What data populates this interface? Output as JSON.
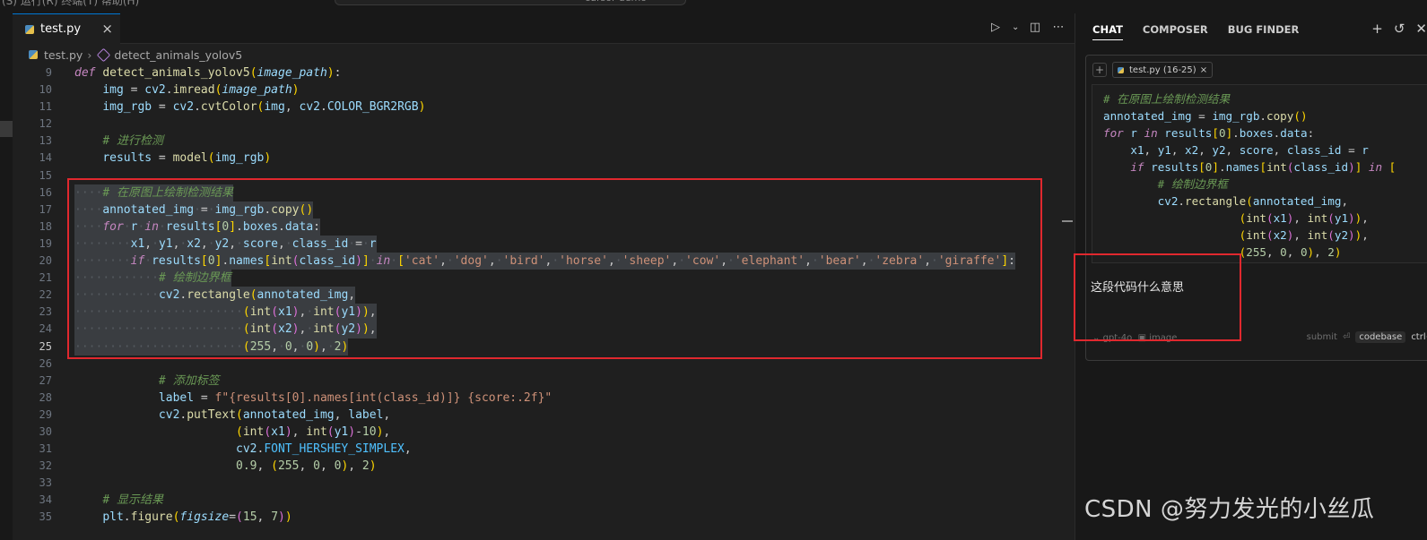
{
  "topbar": {
    "menu_text": "(S)  运行(R)  终端(T)  帮助(H)",
    "command_center": "cursor-demo"
  },
  "tab": {
    "filename": "test.py",
    "close": "×"
  },
  "editor_actions": [
    "run-icon",
    "chevron-down-icon",
    "split-editor-icon",
    "more-icon"
  ],
  "breadcrumb": {
    "file": "test.py",
    "symbol": "detect_animals_yolov5"
  },
  "code_lines": [
    {
      "n": "9",
      "text": "def detect_animals_yolov5(image_path):"
    },
    {
      "n": "10",
      "text": "    img = cv2.imread(image_path)"
    },
    {
      "n": "11",
      "text": "    img_rgb = cv2.cvtColor(img, cv2.COLOR_BGR2RGB)"
    },
    {
      "n": "12",
      "text": ""
    },
    {
      "n": "13",
      "text": "    # 进行检测"
    },
    {
      "n": "14",
      "text": "    results = model(img_rgb)"
    },
    {
      "n": "15",
      "text": ""
    },
    {
      "n": "16",
      "text": "    # 在原图上绘制检测结果"
    },
    {
      "n": "17",
      "text": "    annotated_img = img_rgb.copy()"
    },
    {
      "n": "18",
      "text": "    for r in results[0].boxes.data:"
    },
    {
      "n": "19",
      "text": "        x1, y1, x2, y2, score, class_id = r"
    },
    {
      "n": "20",
      "text": "        if results[0].names[int(class_id)] in ['cat', 'dog', 'bird', 'horse', 'sheep', 'cow', 'elephant', 'bear', 'zebra', 'giraffe']:"
    },
    {
      "n": "21",
      "text": "            # 绘制边界框"
    },
    {
      "n": "22",
      "text": "            cv2.rectangle(annotated_img,"
    },
    {
      "n": "23",
      "text": "                        (int(x1), int(y1)),"
    },
    {
      "n": "24",
      "text": "                        (int(x2), int(y2)),"
    },
    {
      "n": "25",
      "text": "                        (255, 0, 0), 2)"
    },
    {
      "n": "26",
      "text": ""
    },
    {
      "n": "27",
      "text": "            # 添加标签"
    },
    {
      "n": "28",
      "text": "            label = f\"{results[0].names[int(class_id)]} {score:.2f}\""
    },
    {
      "n": "29",
      "text": "            cv2.putText(annotated_img, label,"
    },
    {
      "n": "30",
      "text": "                       (int(x1), int(y1)-10),"
    },
    {
      "n": "31",
      "text": "                       cv2.FONT_HERSHEY_SIMPLEX,"
    },
    {
      "n": "32",
      "text": "                       0.9, (255, 0, 0), 2)"
    },
    {
      "n": "33",
      "text": ""
    },
    {
      "n": "34",
      "text": "    # 显示结果"
    },
    {
      "n": "35",
      "text": "    plt.figure(figsize=(15, 7))"
    }
  ],
  "chat": {
    "tabs": [
      "CHAT",
      "COMPOSER",
      "BUG FINDER"
    ],
    "header_icons": [
      "plus-icon",
      "history-icon",
      "close-icon"
    ],
    "context_plus": "+",
    "context_pill": "test.py (16-25)",
    "context_pill_close": "×",
    "snippet_lines": [
      "# 在原图上绘制检测结果",
      "annotated_img = img_rgb.copy()",
      "for r in results[0].boxes.data:",
      "    x1, y1, x2, y2, score, class_id = r",
      "    if results[0].names[int(class_id)] in [",
      "        # 绘制边界框",
      "        cv2.rectangle(annotated_img,",
      "                    (int(x1), int(y1)),",
      "                    (int(x2), int(y2)),",
      "                    (255, 0, 0), 2)"
    ],
    "question": "这段代码什么意思",
    "model": "gpt-4o",
    "image_label": "image",
    "submit": "submit",
    "codebase": "codebase",
    "shortcut": "ctrl+"
  },
  "watermark": "CSDN @努力发光的小丝瓜",
  "colors": {
    "highlight_box": "#e0282e",
    "background": "#1f1f1f",
    "selection": "#3a3d41"
  }
}
